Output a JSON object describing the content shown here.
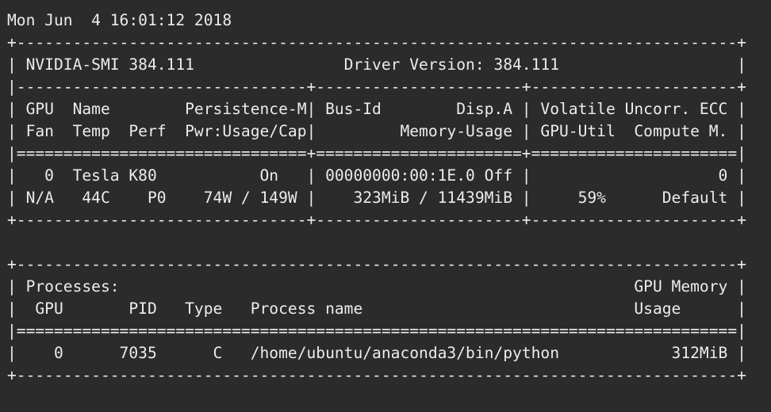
{
  "terminal": {
    "lines": [
      "Mon Jun  4 16:01:12 2018",
      "+-----------------------------------------------------------------------------+",
      "| NVIDIA-SMI 384.111                Driver Version: 384.111                   |",
      "|-------------------------------+----------------------+----------------------+",
      "| GPU  Name        Persistence-M| Bus-Id        Disp.A | Volatile Uncorr. ECC |",
      "| Fan  Temp  Perf  Pwr:Usage/Cap|         Memory-Usage | GPU-Util  Compute M. |",
      "|===============================+======================+======================|",
      "|   0  Tesla K80           On   | 00000000:00:1E.0 Off |                    0 |",
      "| N/A   44C    P0    74W / 149W |    323MiB / 11439MiB |     59%      Default |",
      "+-------------------------------+----------------------+----------------------+",
      "",
      "+-----------------------------------------------------------------------------+",
      "| Processes:                                                       GPU Memory |",
      "|  GPU       PID   Type   Process name                             Usage      |",
      "|=============================================================================|",
      "|    0      7035      C   /home/ubuntu/anaconda3/bin/python            312MiB |",
      "+-----------------------------------------------------------------------------+"
    ]
  }
}
